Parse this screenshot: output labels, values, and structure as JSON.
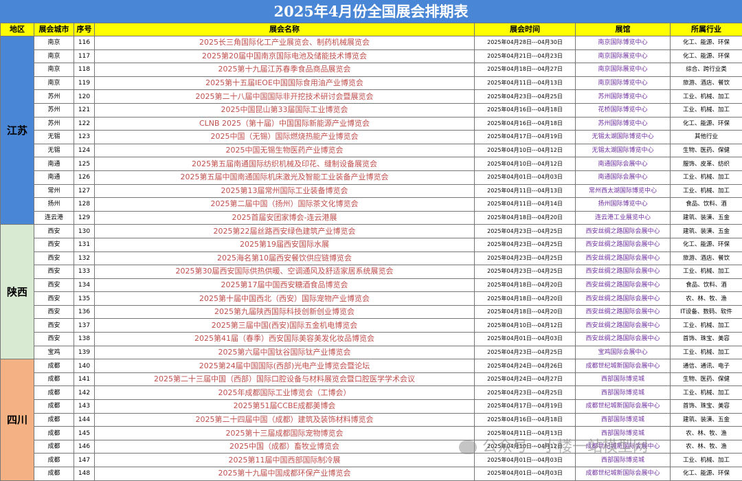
{
  "title": "2025年4月份全国展会排期表",
  "headers": {
    "region": "地区",
    "city": "展会城市",
    "no": "序号",
    "name": "展会名称",
    "date": "展会时间",
    "venue": "展馆",
    "industry": "所属行业"
  },
  "regions": [
    {
      "name": "江苏",
      "color": "#4a86d6",
      "rows": [
        {
          "city": "南京",
          "no": "116",
          "name": "2025长三角国际化工产业展览会、制药机械展览会",
          "date": "2025年04月28日---04月30日",
          "venue": "南京国际博览中心",
          "industry": "化工、能源、环保"
        },
        {
          "city": "南京",
          "no": "117",
          "name": "2025第20届中国南京国际电池及储能技术博览会",
          "date": "2025年04月21日---04月23日",
          "venue": "南京国际展览中心",
          "industry": "化工、能源、环保"
        },
        {
          "city": "南京",
          "no": "118",
          "name": "2025第十九届江苏春季食品商品展览会",
          "date": "2025年04月18日---04月27日",
          "venue": "南京国际展览中心",
          "industry": "综合、跨行业类"
        },
        {
          "city": "南京",
          "no": "119",
          "name": "2025第十五届IEOE中国国际食用油产业博览会",
          "date": "2025年04月11日---04月13日",
          "venue": "南京国际博览中心",
          "industry": "旅游、酒店、餐饮"
        },
        {
          "city": "苏州",
          "no": "120",
          "name": "2025第二十八届中国国际非开挖技术研讨会暨展览会",
          "date": "2025年04月23日---04月25日",
          "venue": "苏州国际博览中心",
          "industry": "工业、机械、加工"
        },
        {
          "city": "苏州",
          "no": "121",
          "name": "2025中国昆山第33届国际工业博览会",
          "date": "2025年04月16日---04月18日",
          "venue": "花桥国际博览中心",
          "industry": "工业、机械、加工"
        },
        {
          "city": "苏州",
          "no": "122",
          "name": "CLNB 2025（第十届）中国国际新能源产业博览会",
          "date": "2025年04月16日---04月18日",
          "venue": "苏州国际博览中心",
          "industry": "化工、能源、环保"
        },
        {
          "city": "无锡",
          "no": "123",
          "name": "2025中国（无锡）国际燃烧热能产业博览会",
          "date": "2025年04月17日---04月19日",
          "venue": "无锡太湖国际博览中心",
          "industry": "其他行业"
        },
        {
          "city": "无锡",
          "no": "124",
          "name": "2025中国无锡生物医药产业博览会",
          "date": "2025年04月10日---04月12日",
          "venue": "无锡太湖国际博览中心",
          "industry": "生物、医药、保健"
        },
        {
          "city": "南通",
          "no": "125",
          "name": "2025第五届南通国际纺织机械及印花、缝制设备展览会",
          "date": "2025年04月10日---04月12日",
          "venue": "南通国际会展中心",
          "industry": "服饰、皮革、纺织"
        },
        {
          "city": "南通",
          "no": "126",
          "name": "2025第五届中国南通国际机床激光及智能工业装备产业博览会",
          "date": "2025年04月01日---04月03日",
          "venue": "南通国际会展中心",
          "industry": "工业、机械、加工"
        },
        {
          "city": "常州",
          "no": "127",
          "name": "2025第13届常州国际工业装备博览会",
          "date": "2025年04月11日---04月13日",
          "venue": "常州西太湖国际博览中心",
          "industry": "工业、机械、加工"
        },
        {
          "city": "扬州",
          "no": "128",
          "name": "2025第二届中国（扬州）国际茶文化博览会",
          "date": "2025年04月11日---04月14日",
          "venue": "扬州国际博览中心",
          "industry": "食品、饮料、酒"
        },
        {
          "city": "连云港",
          "no": "129",
          "name": "2025首届安团家博会-连云港展",
          "date": "2025年04月18日---04月20日",
          "venue": "连云港工业展览中心",
          "industry": "建筑、装潢、五金"
        }
      ]
    },
    {
      "name": "陕西",
      "color": "#d9ead3",
      "rows": [
        {
          "city": "西安",
          "no": "130",
          "name": "2025第22届丝路西安绿色建筑产业博览会",
          "date": "2025年04月23日---04月25日",
          "venue": "西安丝绸之路国际会展中心",
          "industry": "建筑、装潢、五金"
        },
        {
          "city": "西安",
          "no": "131",
          "name": "2025第19届西安国际水展",
          "date": "2025年04月23日---04月25日",
          "venue": "西安丝绸之路国际会展中心",
          "industry": "化工、能源、环保"
        },
        {
          "city": "西安",
          "no": "132",
          "name": "2025海名第10届西安餐饮供应链博览会",
          "date": "2025年04月23日---04月25日",
          "venue": "西安丝绸之路国际会展中心",
          "industry": "旅游、酒店、餐饮"
        },
        {
          "city": "西安",
          "no": "133",
          "name": "2025第30届西安国际供热供暖、空调通风及舒适家居系统展览会",
          "date": "2025年04月23日---04月25日",
          "venue": "西安丝绸之路国际会展中心",
          "industry": "工业、机械、加工"
        },
        {
          "city": "西安",
          "no": "134",
          "name": "2025第17届中国西安糖酒食品博览会",
          "date": "2025年04月18日---04月20日",
          "venue": "西安丝绸之路国际会展中心",
          "industry": "食品、饮料、酒"
        },
        {
          "city": "西安",
          "no": "135",
          "name": "2025第十届中国西北（西安）国际宠物产业博览会",
          "date": "2025年04月18日---04月20日",
          "venue": "西安丝绸之路国际会展中心",
          "industry": "农、林、牧、渔"
        },
        {
          "city": "西安",
          "no": "136",
          "name": "2025第九届陕西国际科技创新创业博览会",
          "date": "2025年04月18日---04月20日",
          "venue": "西安丝绸之路国际会展中心",
          "industry": "IT设备、数码、软件"
        },
        {
          "city": "西安",
          "no": "137",
          "name": "2025第三届中国(西安)国际五金机电博览会",
          "date": "2025年04月10日---04月12日",
          "venue": "西安丝绸之路国际会展中心",
          "industry": "工业、机械、加工"
        },
        {
          "city": "西安",
          "no": "138",
          "name": "2025第41届（春季）西安国际美容美发化妆品博览会",
          "date": "2025年04月01日---04月03日",
          "venue": "西安丝绸之路国际会展中心",
          "industry": "首饰、珠宝、美容"
        },
        {
          "city": "宝鸡",
          "no": "139",
          "name": "2025第六届中国钛谷国际钛产业博览会",
          "date": "2025年04月23日---04月25日",
          "venue": "宝鸡国际会展中心",
          "industry": "工业、机械、加工"
        }
      ]
    },
    {
      "name": "四川",
      "color": "#f4b183",
      "rows": [
        {
          "city": "成都",
          "no": "140",
          "name": "2025第24届中国国际(西部)光电产业博览会暨论坛",
          "date": "2025年04月24日---04月26日",
          "venue": "成都世纪城新国际会展中心",
          "industry": "通信、通讯、电子"
        },
        {
          "city": "成都",
          "no": "141",
          "name": "2025第二十三届中国（西部）国际口腔设备与材料展览会暨口腔医学学术会议",
          "date": "2025年04月24日---04月27日",
          "venue": "西部国际博览城",
          "industry": "生物、医药、保健"
        },
        {
          "city": "成都",
          "no": "142",
          "name": "2025年成都国际工业博览会（工博会）",
          "date": "2025年04月23日---04月25日",
          "venue": "西部国际博览城",
          "industry": "工业、机械、加工"
        },
        {
          "city": "成都",
          "no": "143",
          "name": "2025第51届CCBE成都美博会",
          "date": "2025年04月17日---04月19日",
          "venue": "成都世纪城新国际会展中心",
          "industry": "首饰、珠宝、美容"
        },
        {
          "city": "成都",
          "no": "144",
          "name": "2025第二十四届中国（成都）建筑及装饰材料博览会",
          "date": "2025年04月16日---04月18日",
          "venue": "西部国际博览城",
          "industry": "建筑、装潢、五金"
        },
        {
          "city": "成都",
          "no": "145",
          "name": "2025第十三届成都国际宠物博览会",
          "date": "2025年04月11日---04月13日",
          "venue": "西部国际博览城",
          "industry": "农、林、牧、渔"
        },
        {
          "city": "成都",
          "no": "146",
          "name": "2025中国（成都）畜牧业博览会",
          "date": "2025年04月10日---04月12日",
          "venue": "成都世纪城新国际会展中心",
          "industry": "农、林、牧、渔"
        },
        {
          "city": "成都",
          "no": "147",
          "name": "2025第11届中国西部国际制冷展",
          "date": "2025年04月01日---04月03日",
          "venue": "西部国际博览城",
          "industry": "工业、机械、加工"
        },
        {
          "city": "成都",
          "no": "148",
          "name": "2025第十九届中国成都环保产业博览会",
          "date": "2025年04月01日---04月03日",
          "venue": "成都世纪城新国际会展中心",
          "industry": "化工、能源、环保"
        }
      ]
    }
  ],
  "watermark": "公众号 · 小楼一站模型网"
}
